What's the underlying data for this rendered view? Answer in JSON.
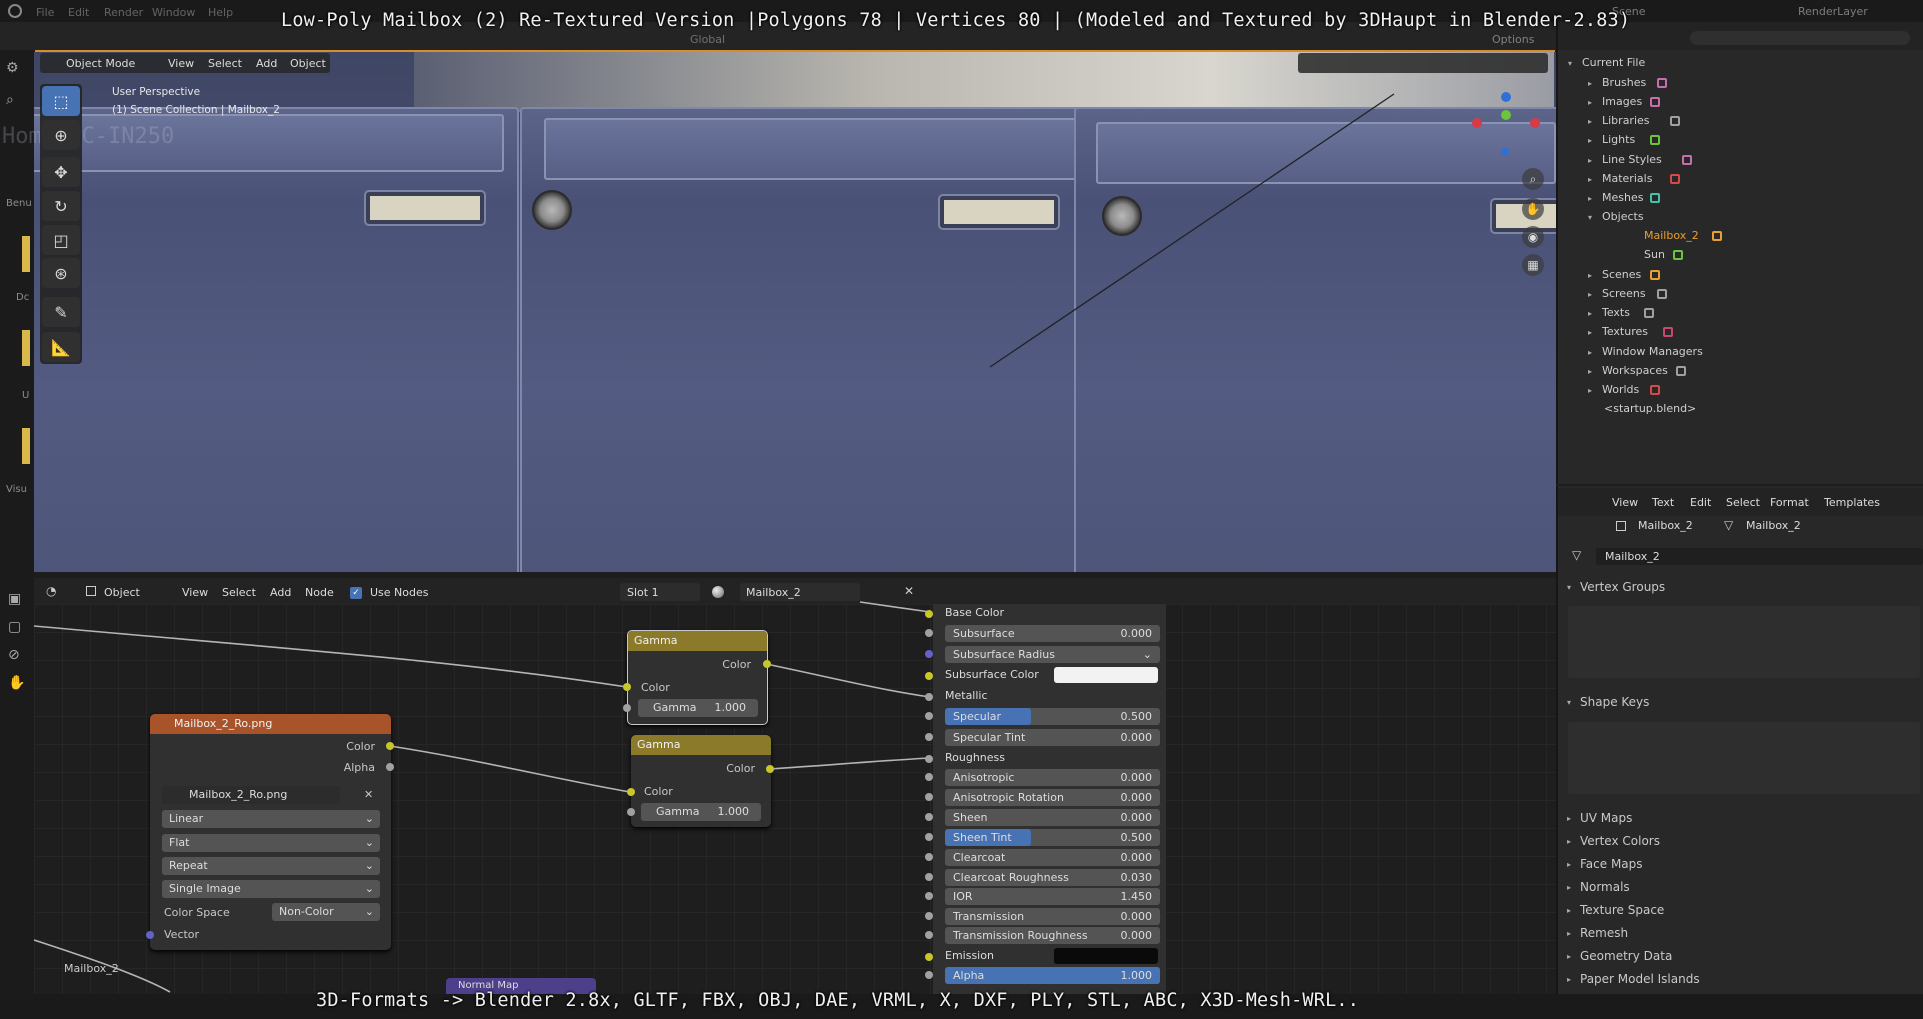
{
  "caption": {
    "top": "Low-Poly Mailbox (2) Re-Textured Version |Polygons 78 | Vertices 80 | (Modeled and Textured by 3DHaupt in Blender-2.83)",
    "bottom": "3D-Formats -> Blender 2.8x, GLTF, FBX, OBJ, DAE, VRML, X, DXF, PLY, STL, ABC, X3D-Mesh-WRL.."
  },
  "top_menu": [
    "File",
    "Edit",
    "Render",
    "Window",
    "Help"
  ],
  "top_right": {
    "scene": "Scene",
    "render_layer": "RenderLayer",
    "transform": "Global",
    "options": "Options"
  },
  "viewport": {
    "mode": "Object Mode",
    "menus": [
      "View",
      "Select",
      "Add",
      "Object"
    ],
    "perspective": "User Perspective",
    "collection": "(1) Scene Collection | Mailbox_2"
  },
  "left_strip": [
    "Benu",
    "Dc",
    "U",
    "Visu"
  ],
  "ghost_text": "Home PC-IN250",
  "outliner": {
    "root": "Current File",
    "items": [
      "Brushes",
      "Images",
      "Libraries",
      "Lights",
      "Line Styles",
      "Materials",
      "Meshes",
      "Objects",
      "Mailbox_2",
      "Sun",
      "Scenes",
      "Screens",
      "Texts",
      "Textures",
      "Window Managers",
      "Workspaces",
      "Worlds",
      "<startup.blend>"
    ]
  },
  "properties": {
    "menus": [
      "View",
      "Text",
      "Edit",
      "Select",
      "Format",
      "Templates"
    ],
    "object": "Mailbox_2",
    "mesh": "Mailbox_2",
    "datablock": "Mailbox_2",
    "panels": [
      "Vertex Groups",
      "Shape Keys",
      "UV Maps",
      "Vertex Colors",
      "Face Maps",
      "Normals",
      "Texture Space",
      "Remesh",
      "Geometry Data",
      "Paper Model Islands"
    ]
  },
  "node_editor": {
    "mode": "Object",
    "menus": [
      "View",
      "Select",
      "Add",
      "Node"
    ],
    "use_nodes": "Use Nodes",
    "slot": "Slot 1",
    "material": "Mailbox_2",
    "frame_label": "Mailbox_2",
    "normal_map": "Normal Map"
  },
  "gamma_node_1": {
    "title": "Gamma",
    "out": "Color",
    "in": "Color",
    "param": "Gamma",
    "value": "1.000"
  },
  "gamma_node_2": {
    "title": "Gamma",
    "out": "Color",
    "in": "Color",
    "param": "Gamma",
    "value": "1.000"
  },
  "image_node": {
    "title": "Mailbox_2_Ro.png",
    "outputs": [
      "Color",
      "Alpha"
    ],
    "image": "Mailbox_2_Ro.png",
    "interpolation": "Linear",
    "projection": "Flat",
    "extension": "Repeat",
    "source": "Single Image",
    "color_space_label": "Color Space",
    "color_space": "Non-Color",
    "vector": "Vector"
  },
  "bsdf": {
    "base_color": "Base Color",
    "subsurface": {
      "label": "Subsurface",
      "value": "0.000"
    },
    "subsurface_radius": "Subsurface Radius",
    "subsurface_color": "Subsurface Color",
    "metallic": "Metallic",
    "specular": {
      "label": "Specular",
      "value": "0.500",
      "fraction": 0.4
    },
    "specular_tint": {
      "label": "Specular Tint",
      "value": "0.000"
    },
    "roughness": "Roughness",
    "anisotropic": {
      "label": "Anisotropic",
      "value": "0.000"
    },
    "anisotropic_rotation": {
      "label": "Anisotropic Rotation",
      "value": "0.000"
    },
    "sheen": {
      "label": "Sheen",
      "value": "0.000"
    },
    "sheen_tint": {
      "label": "Sheen Tint",
      "value": "0.500",
      "fraction": 0.4
    },
    "clearcoat": {
      "label": "Clearcoat",
      "value": "0.000"
    },
    "clearcoat_roughness": {
      "label": "Clearcoat Roughness",
      "value": "0.030"
    },
    "ior": {
      "label": "IOR",
      "value": "1.450"
    },
    "transmission": {
      "label": "Transmission",
      "value": "0.000"
    },
    "transmission_roughness": {
      "label": "Transmission Roughness",
      "value": "0.000"
    },
    "emission": "Emission",
    "alpha": {
      "label": "Alpha",
      "value": "1.000",
      "fraction": 1.0
    }
  },
  "colors": {
    "accent": "#4772b3",
    "gamma_header": "#8a7a2a",
    "image_header": "#a8532a",
    "socket_yellow": "#c7c729",
    "socket_grey": "#a1a1a1",
    "socket_purple": "#6363c7"
  }
}
